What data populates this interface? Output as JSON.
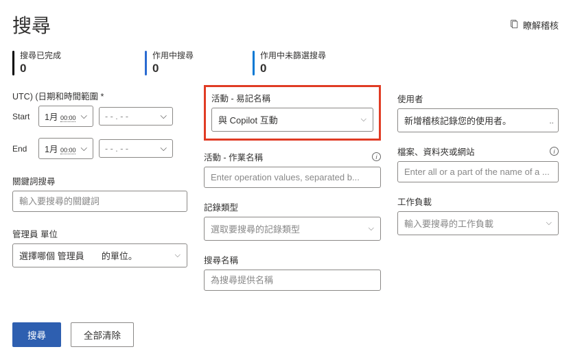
{
  "header": {
    "title": "搜尋",
    "learn_label": "瞭解稽核"
  },
  "stats": {
    "completed_label": "搜尋已完成",
    "completed_value": "0",
    "active_label": "作用中搜尋",
    "active_value": "0",
    "unfiltered_label": "作用中未篩選搜尋",
    "unfiltered_value": "0"
  },
  "left": {
    "date_label": "UTC) (日期和時間範圍 *",
    "start_label": "Start",
    "end_label": "End",
    "date1": "1月",
    "time1": "00:00",
    "date2_placeholder": "- - . - -",
    "keyword_label": "關鍵詞搜尋",
    "keyword_placeholder": "輸入要搜尋的關鍵詞",
    "admin_label": "管理員 單位",
    "admin_text_a": "選擇哪個 管理員",
    "admin_text_b": "的單位。"
  },
  "mid": {
    "activity_friendly_label": "活動 - 易記名稱",
    "activity_friendly_value": "與 Copilot 互動",
    "activity_op_label": "活動 - 作業名稱",
    "activity_op_placeholder": "Enter operation values, separated b...",
    "record_type_label": "記錄類型",
    "record_type_placeholder": "選取要搜尋的記錄類型",
    "search_name_label": "搜尋名稱",
    "search_name_placeholder": "為搜尋提供名稱"
  },
  "right": {
    "users_label": "使用者",
    "users_placeholder": "新增稽核記錄您的使用者。",
    "ffs_label": "檔案、資料夾或網站",
    "ffs_placeholder": "Enter all or a part of the name of a ...",
    "workload_label": "工作負載",
    "workload_placeholder": "輸入要搜尋的工作負載"
  },
  "actions": {
    "search": "搜尋",
    "clear": "全部清除"
  }
}
